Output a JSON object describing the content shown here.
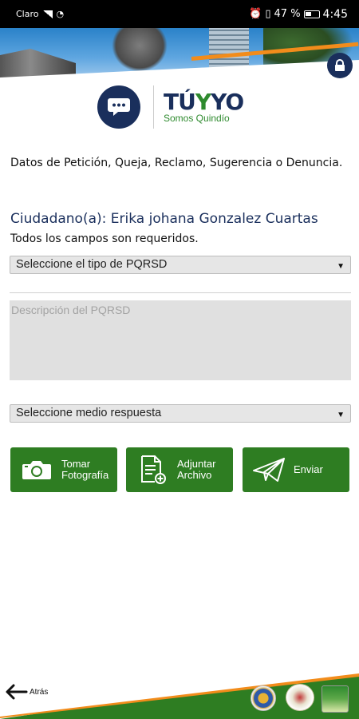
{
  "status_bar": {
    "carrier": "Claro",
    "battery": "47 %",
    "time": "4:45"
  },
  "header": {
    "lock_icon": "lock-icon"
  },
  "logo": {
    "main_prefix": "TÚ",
    "main_v": "Y",
    "main_suffix": "YO",
    "sub": "Somos Quindío"
  },
  "form": {
    "intro": "Datos de Petición, Queja, Reclamo, Sugerencia o Denuncia.",
    "citizen": "Ciudadano(a): Erika johana Gonzalez Cuartas",
    "required": "Todos los campos son requeridos.",
    "type_select": "Seleccione el tipo de PQRSD",
    "description_placeholder": "Descripción del PQRSD",
    "response_select": "Seleccione medio respuesta"
  },
  "buttons": {
    "photo_line1": "Tomar",
    "photo_line2": "Fotografía",
    "attach_line1": "Adjuntar",
    "attach_line2": "Archivo",
    "send": "Enviar"
  },
  "footer": {
    "back_label": "Atrás"
  },
  "colors": {
    "navy": "#1a2f5c",
    "green": "#2e7d22",
    "orange": "#f28c1b"
  }
}
